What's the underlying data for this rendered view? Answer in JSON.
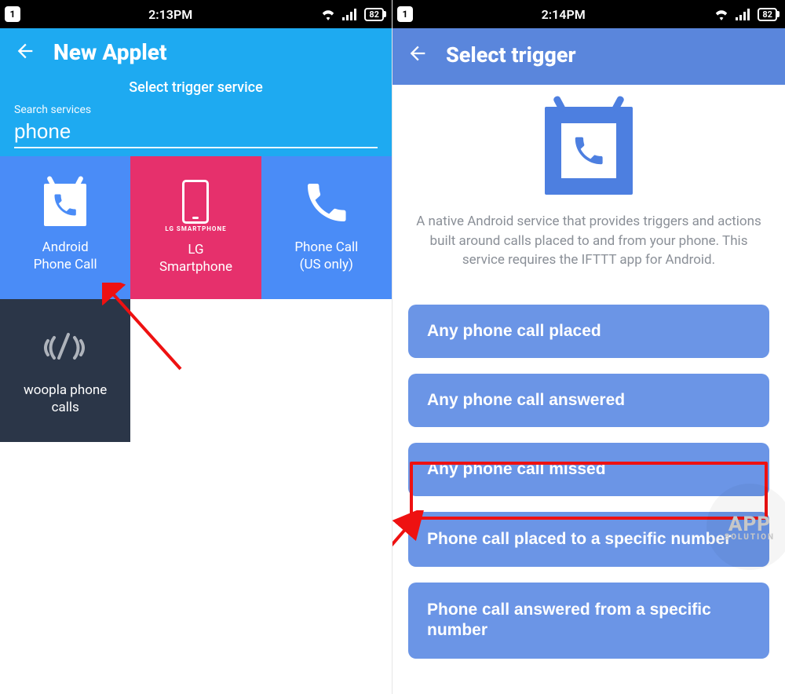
{
  "status": {
    "sim": "1",
    "time_left": "2:13PM",
    "time_right": "2:14PM",
    "battery": "82"
  },
  "left": {
    "title": "New Applet",
    "subtitle": "Select trigger service",
    "search_label": "Search services",
    "search_value": "phone",
    "services": [
      {
        "id": "android-phone-call",
        "label": "Android\nPhone Call",
        "color": "#4a8cf7"
      },
      {
        "id": "lg-smartphone",
        "label": "LG\nSmartphone",
        "sublabel": "LG SMARTPHONE",
        "color": "#e6306c"
      },
      {
        "id": "phone-call-us",
        "label": "Phone Call\n(US only)",
        "color": "#4a8cf7"
      },
      {
        "id": "woopla",
        "label": "woopla phone\ncalls",
        "color": "#2b3648"
      }
    ]
  },
  "right": {
    "title": "Select trigger",
    "description": "A native Android service that provides triggers and actions built around calls placed to and from your phone. This service requires the IFTTT app for Android.",
    "triggers": [
      "Any phone call placed",
      "Any phone call answered",
      "Any phone call missed",
      "Phone call placed to a specific number",
      "Phone call answered from a specific number"
    ],
    "highlighted_index": 2
  },
  "watermark": {
    "line1": "APP",
    "line2": "SOLUTION"
  }
}
